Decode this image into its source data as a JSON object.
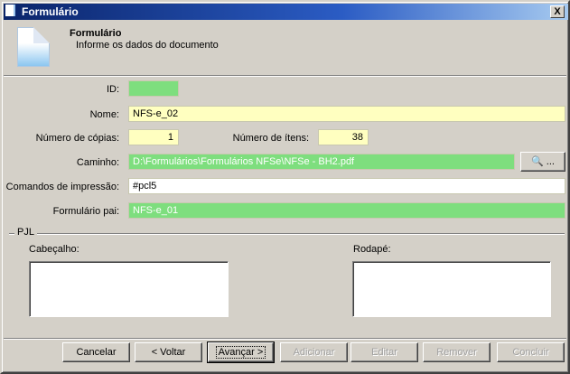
{
  "window": {
    "title": "Formulário",
    "close": "X"
  },
  "header": {
    "title": "Formulário",
    "subtitle": "Informe os dados do documento"
  },
  "form": {
    "id": {
      "label": "ID:",
      "value": ""
    },
    "nome": {
      "label": "Nome:",
      "value": "NFS-e_02"
    },
    "copias": {
      "label": "Número de cópias:",
      "value": "1"
    },
    "itens": {
      "label": "Número de ítens:",
      "value": "38"
    },
    "caminho": {
      "label": "Caminho:",
      "value": "D:\\Formulários\\Formulários NFSe\\NFSe - BH2.pdf",
      "browse": "..."
    },
    "comandos": {
      "label": "Comandos de impressão:",
      "value": "#pcl5"
    },
    "pai": {
      "label": "Formulário pai:",
      "value": "NFS-e_01"
    }
  },
  "pjl": {
    "legend": "PJL",
    "cabecalho": "Cabeçalho:",
    "rodape": "Rodapé:"
  },
  "buttons": {
    "cancel": "Cancelar",
    "back": "< Voltar",
    "next": "Avançar >",
    "add": "Adicionar",
    "edit": "Editar",
    "remove": "Remover",
    "finish": "Concluir"
  },
  "colors": {
    "required": "#7ede7e",
    "edited": "#ffffc0",
    "titlebar": "#0a246a"
  }
}
